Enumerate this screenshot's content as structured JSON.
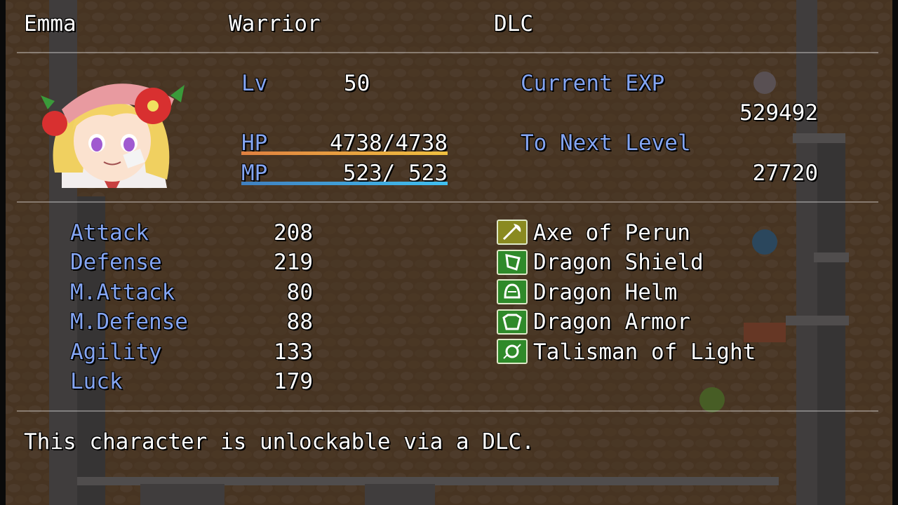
{
  "header": {
    "name": "Emma",
    "class": "Warrior",
    "tag": "DLC"
  },
  "status": {
    "lv_label": "Lv",
    "lv_value": "50",
    "hp_label": "HP",
    "hp_value": "4738/4738",
    "hp_fraction": 1.0,
    "mp_label": "MP",
    "mp_value": "523/ 523",
    "mp_fraction": 1.0,
    "exp_label": "Current EXP",
    "exp_value": "529492",
    "next_label": "To Next Level",
    "next_value": "27720"
  },
  "params": [
    {
      "label": "Attack",
      "value": "208"
    },
    {
      "label": "Defense",
      "value": "219"
    },
    {
      "label": "M.Attack",
      "value": "80"
    },
    {
      "label": "M.Defense",
      "value": "88"
    },
    {
      "label": "Agility",
      "value": "133"
    },
    {
      "label": "Luck",
      "value": "179"
    }
  ],
  "equipment": [
    {
      "name": "Axe of Perun",
      "icon": "axe-icon"
    },
    {
      "name": "Dragon Shield",
      "icon": "shield-icon"
    },
    {
      "name": "Dragon Helm",
      "icon": "helm-icon"
    },
    {
      "name": "Dragon Armor",
      "icon": "armor-icon"
    },
    {
      "name": "Talisman of Light",
      "icon": "talisman-icon"
    }
  ],
  "description": "This character is unlockable via a DLC.",
  "colors": {
    "system_text": "#84a5f2",
    "hp_gauge_start": "#e08040",
    "hp_gauge_end": "#f0c040",
    "mp_gauge_start": "#4080c0",
    "mp_gauge_end": "#40c0f0",
    "icon_green": "#2f8a2a",
    "icon_olive": "#8a8a20"
  }
}
